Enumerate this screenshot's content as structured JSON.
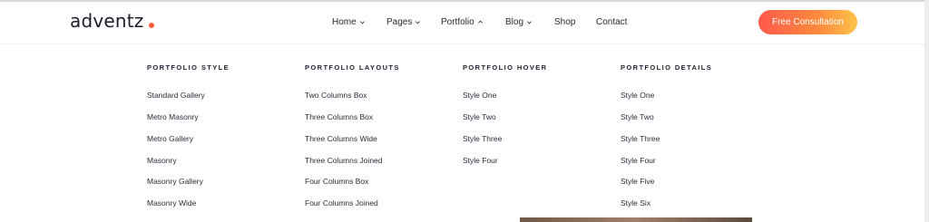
{
  "brand": {
    "logo_text": "adventz",
    "accent": "#ff5a36"
  },
  "nav": {
    "items": [
      {
        "label": "Home",
        "has_dropdown": true
      },
      {
        "label": "Pages",
        "has_dropdown": true
      },
      {
        "label": "Portfolio",
        "has_dropdown": true,
        "open": true
      },
      {
        "label": "Blog",
        "has_dropdown": true
      },
      {
        "label": "Shop",
        "has_dropdown": false
      },
      {
        "label": "Contact",
        "has_dropdown": false
      }
    ]
  },
  "cta": {
    "label": "Free Consultation",
    "gradient": [
      "#ff5a4c",
      "#ff8a3d",
      "#ffc24a"
    ]
  },
  "mega_menu": {
    "columns": [
      {
        "title": "PORTFOLIO STYLE",
        "items": [
          "Standard Gallery",
          "Metro Masonry",
          "Metro Gallery",
          "Masonry",
          "Masonry Gallery",
          "Masonry Wide"
        ]
      },
      {
        "title": "PORTFOLIO LAYOUTS",
        "items": [
          "Two Columns Box",
          "Three Columns Box",
          "Three Columns Wide",
          "Three Columns Joined",
          "Four Columns Box",
          "Four Columns Joined"
        ]
      },
      {
        "title": "PORTFOLIO HOVER",
        "items": [
          "Style One",
          "Style Two",
          "Style Three",
          "Style Four"
        ]
      },
      {
        "title": "PORTFOLIO DETAILS",
        "items": [
          "Style One",
          "Style Two",
          "Style Three",
          "Style Four",
          "Style Five",
          "Style Six"
        ]
      }
    ]
  }
}
